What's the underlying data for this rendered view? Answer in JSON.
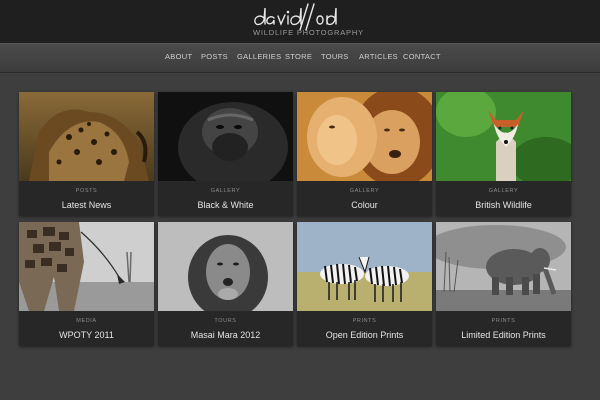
{
  "logo": {
    "script": "david lloyd",
    "tagline": "WILDLIFE PHOTOGRAPHY"
  },
  "nav": [
    "ABOUT",
    "POSTS",
    "GALLERIES",
    "STORE",
    "TOURS",
    "ARTICLES",
    "CONTACT"
  ],
  "tiles": [
    {
      "category": "POSTS",
      "title": "Latest News",
      "photo": "leopard-photo"
    },
    {
      "category": "GALLERY",
      "title": "Black & White",
      "photo": "gorilla-photo"
    },
    {
      "category": "GALLERY",
      "title": "Colour",
      "photo": "lions-photo"
    },
    {
      "category": "GALLERY",
      "title": "British Wildlife",
      "photo": "fox-photo"
    },
    {
      "category": "MEDIA",
      "title": "WPOTY 2011",
      "photo": "giraffe-photo"
    },
    {
      "category": "TOURS",
      "title": "Masai Mara 2012",
      "photo": "lion-photo"
    },
    {
      "category": "PRINTS",
      "title": "Open Edition Prints",
      "photo": "zebras-photo"
    },
    {
      "category": "PRINTS",
      "title": "Limited Edition Prints",
      "photo": "elephant-photo"
    }
  ],
  "colors": {
    "page_bg": "#3e3e3e",
    "header_bg": "#1f1f1f",
    "tile_bg": "#272727"
  }
}
